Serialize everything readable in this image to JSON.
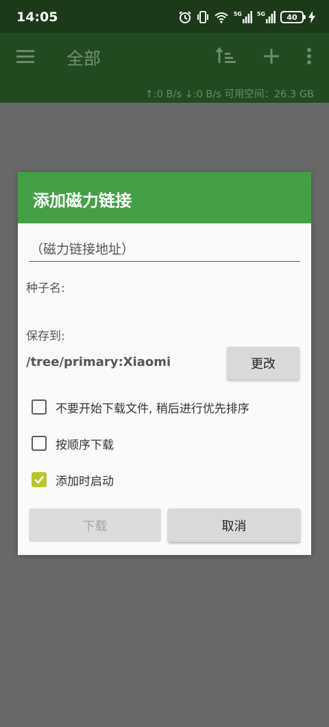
{
  "status_bar": {
    "time": "14:05",
    "network_5g_1": "5G",
    "network_5g_2": "5G",
    "battery": "40",
    "icons": [
      "alarm-icon",
      "vibrate-icon",
      "wifi-icon",
      "signal-5g-icon",
      "signal-5g-icon",
      "battery-icon",
      "charging-icon"
    ]
  },
  "app_bar": {
    "title": "全部",
    "upload_speed": "↑:0 B/s",
    "download_speed": "↓:0 B/s",
    "free_space": "可用空间：26.3 GB",
    "icons": [
      "menu-icon",
      "sort-icon",
      "add-icon",
      "more-vert-icon"
    ]
  },
  "dialog": {
    "title": "添加磁力链接",
    "magnet_placeholder": "（磁力链接地址）",
    "magnet_value": "",
    "torrent_name_label": "种子名:",
    "save_to_label": "保存到:",
    "save_path": "/tree/primary:Xiaomi",
    "change_button": "更改",
    "options": [
      {
        "label": "不要开始下载文件, 稍后进行优先排序",
        "checked": false
      },
      {
        "label": "按顺序下载",
        "checked": false
      },
      {
        "label": "添加时启动",
        "checked": true
      }
    ],
    "download_button": "下载",
    "cancel_button": "取消"
  },
  "colors": {
    "status_bar": "#1c3919",
    "app_bar": "#214a20",
    "dialog_header": "#43a047",
    "checkbox_checked": "#b5c82a",
    "scrim": "#686868"
  }
}
